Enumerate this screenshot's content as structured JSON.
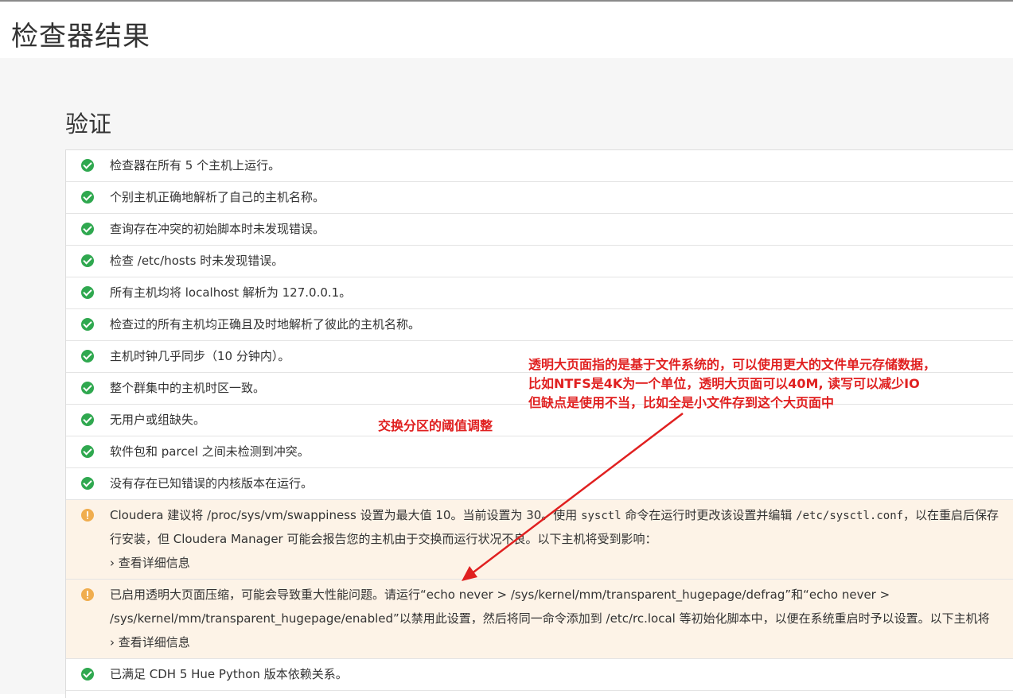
{
  "page": {
    "title": "检查器结果"
  },
  "section": {
    "title": "验证"
  },
  "results": [
    {
      "status": "ok",
      "text": "检查器在所有 5 个主机上运行。"
    },
    {
      "status": "ok",
      "text": "个别主机正确地解析了自己的主机名称。"
    },
    {
      "status": "ok",
      "text": "查询存在冲突的初始脚本时未发现错误。"
    },
    {
      "status": "ok",
      "text": "检查 /etc/hosts 时未发现错误。"
    },
    {
      "status": "ok",
      "text": "所有主机均将 localhost 解析为 127.0.0.1。"
    },
    {
      "status": "ok",
      "text": "检查过的所有主机均正确且及时地解析了彼此的主机名称。"
    },
    {
      "status": "ok",
      "text": "主机时钟几乎同步（10 分钟内）。"
    },
    {
      "status": "ok",
      "text": "整个群集中的主机时区一致。"
    },
    {
      "status": "ok",
      "text": "无用户或组缺失。"
    },
    {
      "status": "ok",
      "text": "软件包和 parcel 之间未检测到冲突。"
    },
    {
      "status": "ok",
      "text": "没有存在已知错误的内核版本在运行。"
    }
  ],
  "warning_swappiness": {
    "line1_a": "Cloudera 建议将 /proc/sys/vm/swappiness 设置为最大值 10。当前设置为 30。使用 ",
    "line1_cmd": "sysctl",
    "line1_b": " 命令在运行时更改该设置并编辑 ",
    "line1_file": "/etc/sysctl.conf",
    "line1_c": "，以在重启后保存",
    "line2": "行安装，但 Cloudera Manager 可能会报告您的主机由于交换而运行状况不良。以下主机将受到影响：",
    "details": "› 查看详细信息"
  },
  "warning_hugepage": {
    "line1": "已启用透明大页面压缩，可能会导致重大性能问题。请运行“echo never > /sys/kernel/mm/transparent_hugepage/defrag”和“echo never >",
    "line2": "/sys/kernel/mm/transparent_hugepage/enabled”以禁用此设置，然后将同一命令添加到 /etc/rc.local 等初始化脚本中，以便在系统重启时予以设置。以下主机将",
    "details": "› 查看详细信息"
  },
  "last_result": {
    "status": "ok",
    "text": "已满足 CDH 5 Hue Python 版本依赖关系。"
  },
  "annotations": {
    "hugepage_note": [
      "透明大页面指的是基于文件系统的，可以使用更大的文件单元存储数据，",
      "比如NTFS是4K为一个单位，透明大页面可以40M, 读写可以减少IO",
      "但缺点是使用不当，比如全是小文件存到这个大页面中"
    ],
    "swap_note": "交换分区的阈值调整"
  },
  "colors": {
    "ok": "#2fa84f",
    "warn": "#f0ad4e",
    "warn_bg": "#fdf3e7",
    "annotation": "#e02020"
  }
}
